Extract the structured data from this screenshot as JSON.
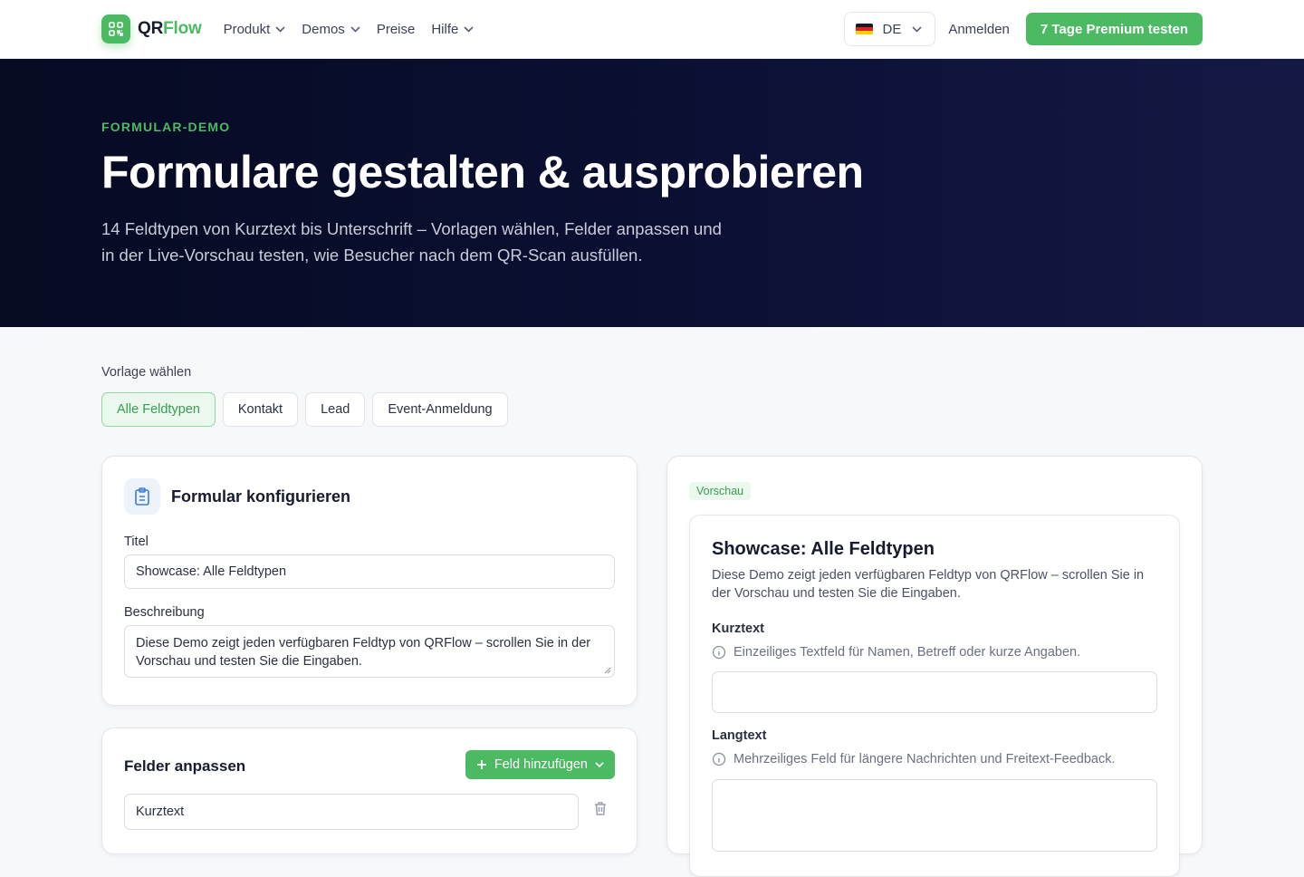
{
  "nav": {
    "logo_qr": "QR",
    "logo_flow": "Flow",
    "menu": [
      {
        "label": "Produkt",
        "has_dropdown": true
      },
      {
        "label": "Demos",
        "has_dropdown": true
      },
      {
        "label": "Preise",
        "has_dropdown": false
      },
      {
        "label": "Hilfe",
        "has_dropdown": true
      }
    ],
    "language": "DE",
    "signin": "Anmelden",
    "cta": "7 Tage Premium testen"
  },
  "hero": {
    "eyebrow": "FORMULAR-DEMO",
    "title": "Formulare gestalten & ausprobieren",
    "subtitle": "14 Feldtypen von Kurztext bis Unterschrift – Vorlagen wählen, Felder anpassen und in der Live-Vorschau testen, wie Besucher nach dem QR-Scan ausfüllen."
  },
  "templates": {
    "label": "Vorlage wählen",
    "options": [
      "Alle Feldtypen",
      "Kontakt",
      "Lead",
      "Event-Anmeldung"
    ],
    "active": "Alle Feldtypen"
  },
  "config": {
    "heading": "Formular konfigurieren",
    "title_label": "Titel",
    "title_value": "Showcase: Alle Feldtypen",
    "description_label": "Beschreibung",
    "description_value": "Diese Demo zeigt jeden verfügbaren Feldtyp von QRFlow – scrollen Sie in der Vorschau und testen Sie die Eingaben."
  },
  "fields": {
    "heading": "Felder anpassen",
    "add_button": "Feld hinzufügen",
    "first_field": "Kurztext"
  },
  "preview": {
    "badge": "Vorschau",
    "title": "Showcase: Alle Feldtypen",
    "description": "Diese Demo zeigt jeden verfügbaren Feldtyp von QRFlow – scrollen Sie in der Vorschau und testen Sie die Eingaben.",
    "fields": [
      {
        "label": "Kurztext",
        "hint": "Einzeiliges Textfeld für Namen, Betreff oder kurze Angaben."
      },
      {
        "label": "Langtext",
        "hint": "Mehrzeiliges Feld für längere Nachrichten und Freitext-Feedback."
      }
    ]
  },
  "colors": {
    "accent": "#4cb963",
    "hero_bg": "#0b1034"
  }
}
